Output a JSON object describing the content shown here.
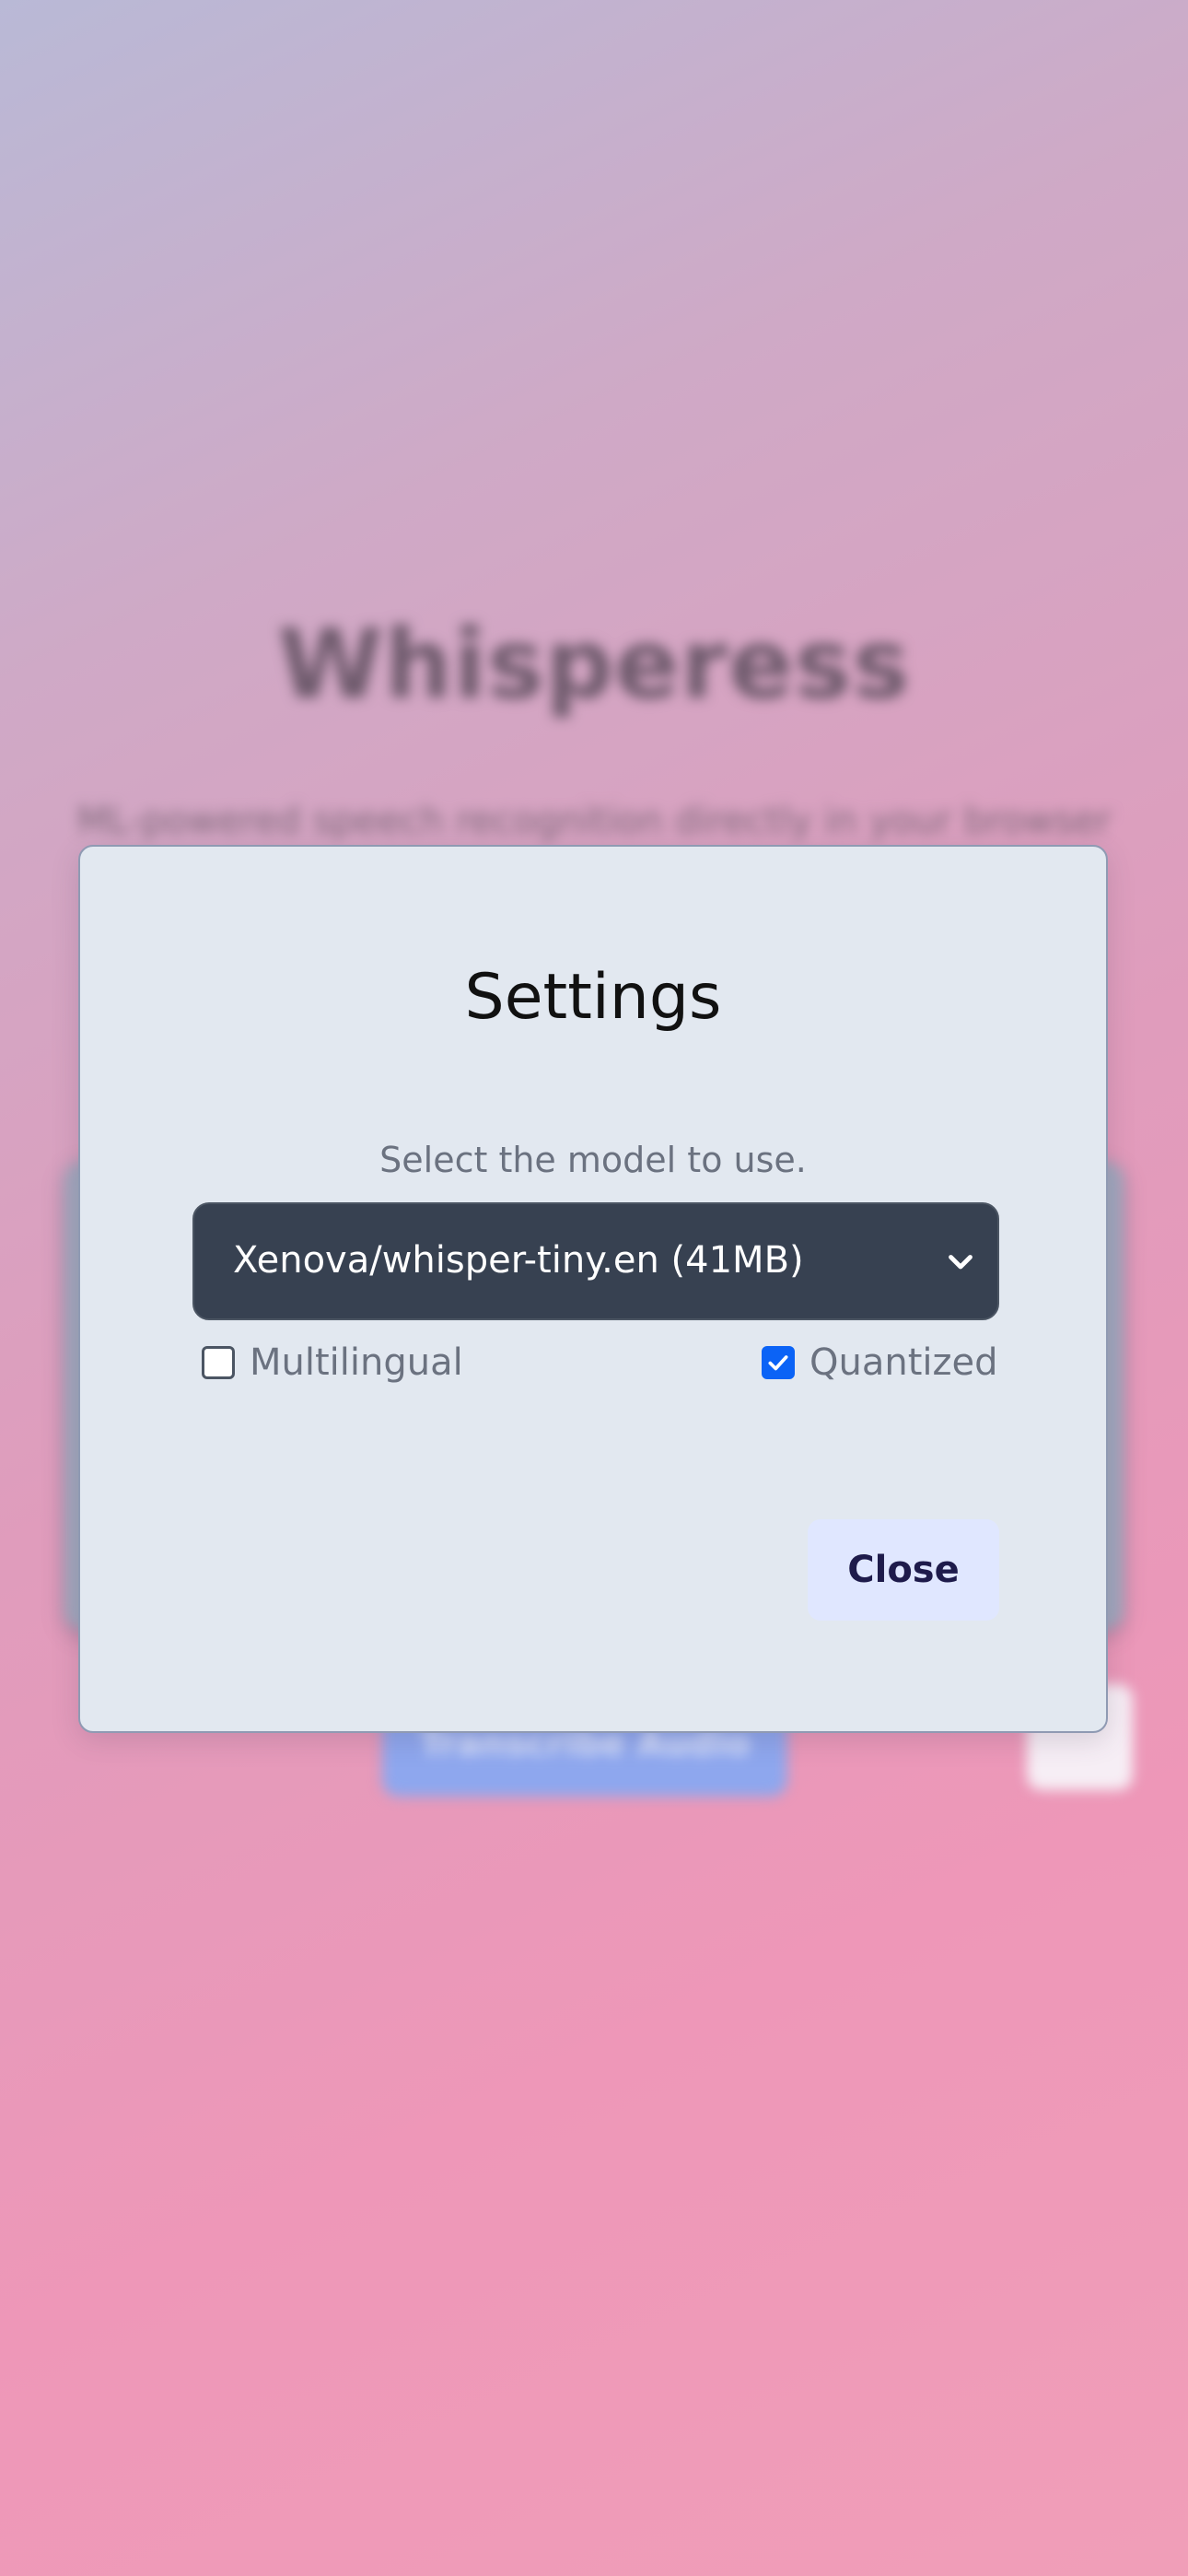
{
  "background": {
    "title": "Whisperess",
    "subtitle": "ML-powered speech recognition directly in your browser",
    "primary_button_label": "Transcribe Audio"
  },
  "modal": {
    "title": "Settings",
    "description": "Select the model to use.",
    "model_select": {
      "selected": "Xenova/whisper-tiny.en (41MB)"
    },
    "options": [
      {
        "label": "Multilingual",
        "checked": false
      },
      {
        "label": "Quantized",
        "checked": true
      }
    ],
    "close_label": "Close"
  },
  "colors": {
    "accent": "#0b63f6",
    "select_bg": "#374151",
    "modal_bg": "#e2e8f0",
    "close_bg": "#e0e7ff"
  }
}
